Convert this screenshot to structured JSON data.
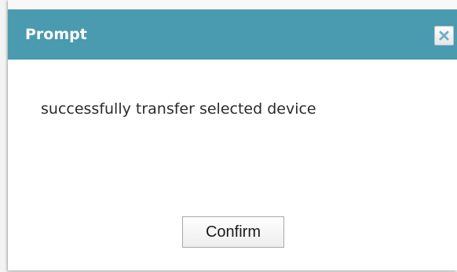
{
  "dialog": {
    "title": "Prompt",
    "close_icon": "close-icon",
    "message": "successfully transfer selected device",
    "confirm_label": "Confirm"
  },
  "colors": {
    "titlebar": "#4a9ab0",
    "title_text": "#ffffff",
    "content_bg": "#ffffff",
    "close_x": "#6fb0c6"
  }
}
